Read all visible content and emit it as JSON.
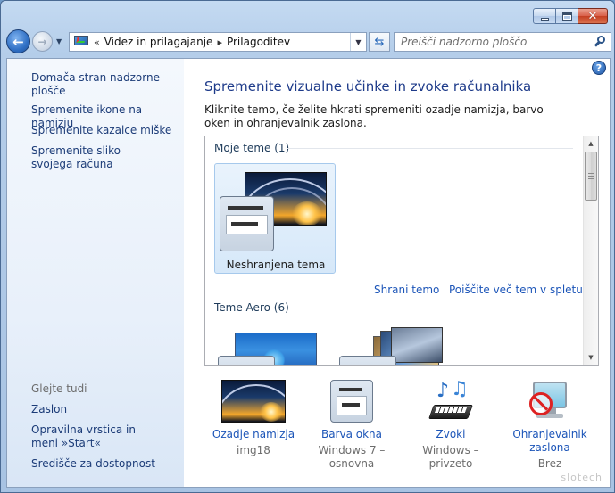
{
  "window": {
    "caption_buttons": {
      "minimize_icon": "minimize-icon",
      "maximize_icon": "maximize-icon",
      "close_icon": "close-icon"
    }
  },
  "nav": {
    "back_icon": "back-arrow-icon",
    "forward_icon": "forward-arrow-icon",
    "history_dropdown_icon": "chevron-down-icon",
    "breadcrumb_overflow": "«",
    "breadcrumb": [
      "Videz in prilagajanje",
      "Prilagoditev"
    ],
    "breadcrumb_separator": "▸",
    "refresh_icon": "refresh-icon",
    "search_placeholder": "Preišči nadzorno ploščo",
    "search_icon": "search-icon"
  },
  "sidebar": {
    "home_link": "Domača stran nadzorne plošče",
    "links": [
      "Spremenite ikone na namizju",
      "Spremenite kazalce miške",
      "Spremenite sliko svojega računa"
    ],
    "see_also_heading": "Glejte tudi",
    "see_also": [
      "Zaslon",
      "Opravilna vrstica in meni »Start«",
      "Središče za dostopnost"
    ]
  },
  "main": {
    "help_icon": "help-icon",
    "help_glyph": "?",
    "title": "Spremenite vizualne učinke in zvoke računalnika",
    "description": "Kliknite temo, če želite hkrati spremeniti ozadje namizja, barvo oken in ohranjevalnik zaslona.",
    "groups": [
      {
        "label": "Moje teme (1)",
        "themes": [
          {
            "label": "Neshranjena tema",
            "selected": true
          }
        ]
      },
      {
        "label": "Teme Aero (6)"
      }
    ],
    "save_theme_link": "Shrani temo",
    "more_themes_link": "Poiščite več tem v spletu",
    "settings": [
      {
        "label": "Ozadje namizja",
        "value": "img18",
        "icon": "desktop-background-icon"
      },
      {
        "label": "Barva okna",
        "value": "Windows 7 – osnovna",
        "icon": "window-color-icon"
      },
      {
        "label": "Zvoki",
        "value": "Windows – privzeto",
        "icon": "sounds-icon"
      },
      {
        "label": "Ohranjevalnik zaslona",
        "value": "Brez",
        "icon": "screensaver-icon"
      }
    ]
  },
  "watermark": "slotech",
  "colors": {
    "link": "#1c55b8",
    "title": "#1e3b8a",
    "sidebar_link": "#1c3c78",
    "muted": "#6d6d6d"
  }
}
